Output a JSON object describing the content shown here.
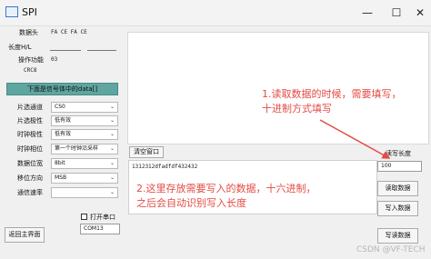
{
  "title": "SPI",
  "window_buttons": {
    "minimize": "—",
    "maximize": "☐",
    "close": "✕"
  },
  "left": {
    "header_label": "数据头",
    "header_value": "FA CE FA CE",
    "length_label": "长度H/L",
    "op_label": "操作功能",
    "op_value": "03",
    "crc_label": "CRC8",
    "teal_button": "下面是信号体中的data[]",
    "rows": [
      {
        "label": "片选通道",
        "value": "CS0"
      },
      {
        "label": "片选极性",
        "value": "低有效"
      },
      {
        "label": "时钟极性",
        "value": "低有效"
      },
      {
        "label": "时钟相位",
        "value": "第一个时钟沿采样"
      },
      {
        "label": "数据位宽",
        "value": "8bit"
      },
      {
        "label": "移位方向",
        "value": "MSB"
      },
      {
        "label": "通信速率",
        "value": ""
      }
    ],
    "open_port_label": "打开串口",
    "com_value": "COM13",
    "back_button": "返回主界面"
  },
  "right": {
    "clear_button": "清空窗口",
    "read_len_label": "读写长度",
    "read_len_value": "100",
    "data_value": "1312312dfadfdf432432",
    "buttons": [
      "读取数据",
      "写入数据",
      "写读数据"
    ]
  },
  "annotations": {
    "note1_line1": "1.读取数据的时候，需要填写，",
    "note1_line2": "十进制方式填写",
    "note2_line1": "2.这里存放需要写入的数据，十六进制，",
    "note2_line2": "之后会自动识别写入长度"
  },
  "watermark": "CSDN @VF-TECH",
  "colors": {
    "annotation": "#e34b44",
    "teal_button": "#5fa6a0"
  }
}
